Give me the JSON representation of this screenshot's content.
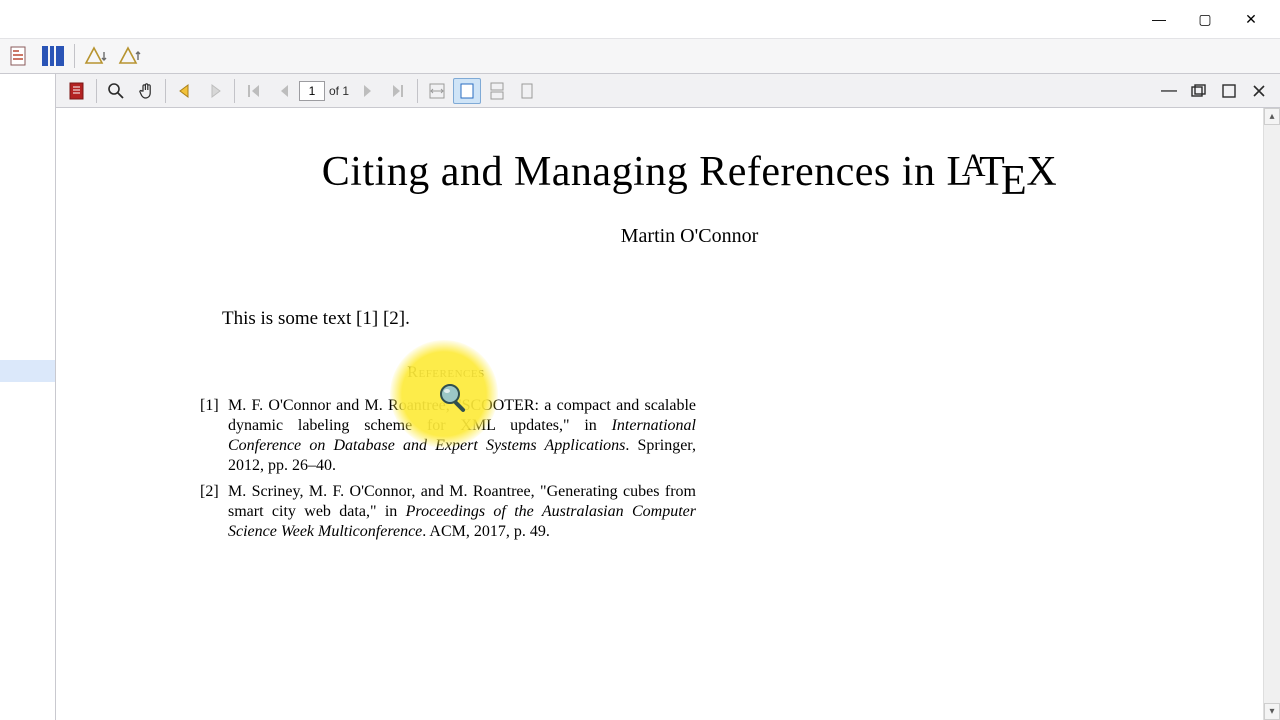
{
  "window": {
    "minimize": "—",
    "maximize": "▢",
    "close": "✕"
  },
  "pdf_toolbar": {
    "page_current": "1",
    "page_of": "of 1"
  },
  "doc": {
    "title_pre": "Citing and Managing References in ",
    "latex": {
      "l": "L",
      "a": "A",
      "t": "T",
      "e": "E",
      "x": "X"
    },
    "author": "Martin O'Connor",
    "body": "This is some text [1] [2].",
    "refs_heading": "References",
    "refs": [
      {
        "num": "[1]",
        "pre": "M. F. O'Connor and M. Roantree, \"SCOOTER: a compact and scalable dynamic labeling scheme for XML updates,\" in ",
        "ital": "International Conference on Database and Expert Systems Applications",
        "post": ".   Springer, 2012, pp. 26–40."
      },
      {
        "num": "[2]",
        "pre": "M. Scriney, M. F. O'Connor, and M. Roantree, \"Generating cubes from smart city web data,\" in ",
        "ital": "Proceedings of the Australasian Computer Science Week Multiconference",
        "post": ".   ACM, 2017, p. 49."
      }
    ]
  }
}
